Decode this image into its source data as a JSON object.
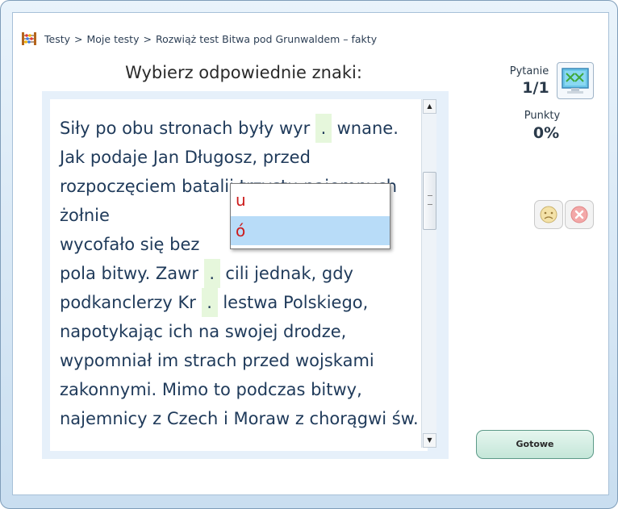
{
  "breadcrumb": {
    "items": [
      "Testy",
      "Moje testy",
      "Rozwiąż test Bitwa pod Grunwaldem – fakty"
    ],
    "separator": ">"
  },
  "instruction": "Wybierz odpowiednie znaki:",
  "passage": {
    "before_gap1": "Siły po obu stronach były wyr",
    "gap1": ".",
    "after_gap1": "wnane. Jak podaje Jan Długosz, przed rozpoczęciem batalii trzystu najemnych żołnie",
    "middle": "wycofało się bez",
    "line6_start": "pola bitwy. Zawr",
    "gap_zawr": ".",
    "line6_end": "cili jednak, gdy",
    "line7_start": "podkanclerzy Kr",
    "gap_kr": ".",
    "line7_end": "lestwa",
    "rest": "Polskiego, napotykając ich na swojej drodze, wypomniał im strach przed wojskami zakonnymi. Mimo to podczas bitwy, najemnicy z Czech i Moraw z chorągwi św."
  },
  "dropdown": {
    "options": [
      "u",
      "ó"
    ],
    "selected_index": 1
  },
  "scrollbar": {
    "up_glyph": "▲",
    "down_glyph": "▼"
  },
  "sidebar": {
    "question_label": "Pytanie",
    "question_value": "1/1",
    "points_label": "Punkty",
    "points_value": "0%"
  },
  "ready_button": "Gotowe",
  "icons": {
    "breadcrumb": "abacus-icon",
    "question": "monitor-icon",
    "hint": "sad-face-icon",
    "cancel": "close-icon"
  },
  "colors": {
    "gap_bg": "#e6f7dc",
    "option_text": "#cc1a1a",
    "option_selected_bg": "#b8dcf8",
    "ready_bg": "#c4e6d8"
  }
}
